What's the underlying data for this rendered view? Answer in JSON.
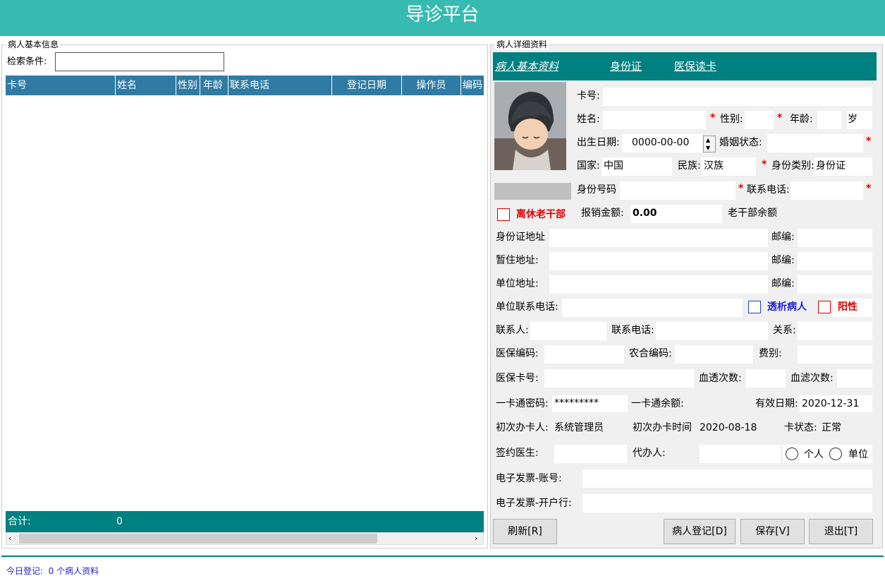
{
  "app": {
    "title": "导诊平台"
  },
  "left": {
    "group_title": "病人基本信息",
    "search_label": "检索条件:",
    "search_value": "",
    "columns": [
      "卡号",
      "姓名",
      "性别",
      "年龄",
      "联系电话",
      "登记日期",
      "操作员",
      "编码"
    ],
    "total_label": "合计:",
    "total_value": "0"
  },
  "right": {
    "group_title": "病人详细资料",
    "tabs": [
      "病人基本资料",
      "身份证",
      "医保读卡"
    ],
    "labels": {
      "card_no": "卡号:",
      "name": "姓名:",
      "gender": "性别:",
      "age": "年龄:",
      "age_unit": "岁",
      "birth_date": "出生日期:",
      "marital": "婚姻状态:",
      "country": "国家:",
      "ethnicity": "民族:",
      "id_type": "身份类别:",
      "id_no": "身份号码",
      "phone": "联系电话:",
      "retired": "离休老干部",
      "reimburse": "报销金额:",
      "cadre_balance": "老干部余额",
      "id_address": "身份证地址",
      "postcode": "邮编:",
      "temp_address": "暂住地址:",
      "work_address": "单位地址:",
      "work_phone": "单位联系电话:",
      "dialysis": "透析病人",
      "positive": "阳性",
      "contact": "联系人:",
      "contact_phone": "联系电话:",
      "relation": "关系:",
      "ins_code": "医保编码:",
      "coop_code": "农合编码:",
      "fee_type": "费别:",
      "ins_card": "医保卡号:",
      "dialysis_count": "血透次数:",
      "filter_count": "血滤次数:",
      "card_pwd": "一卡通密码:",
      "card_balance": "一卡通余额:",
      "valid_date": "有效日期:",
      "first_issuer": "初次办卡人:",
      "first_time": "初次办卡时间",
      "card_state": "卡状态:",
      "doctor": "签约医生:",
      "agent": "代办人:",
      "radio_personal": "个人",
      "radio_unit": "单位",
      "invoice_account": "电子发票-账号:",
      "invoice_bank": "电子发票-开户行:"
    },
    "values": {
      "birth_date": "0000-00-00",
      "country": "中国",
      "ethnicity": "汉族",
      "id_type": "身份证",
      "reimburse": "0.00",
      "card_pwd": "*********",
      "valid_date": "2020-12-31",
      "first_issuer": "系统管理员",
      "first_time": "2020-08-18",
      "card_state": "正常"
    },
    "buttons": {
      "refresh": "刷新[R]",
      "register": "病人登记[D]",
      "save": "保存[V]",
      "exit": "退出[T]"
    }
  },
  "status": {
    "text": "今日登记:  0 个病人资料"
  },
  "colors": {
    "header": "#37bbb1",
    "teal": "#008080",
    "table_header": "#2f7ba4",
    "required": "#e00000",
    "status_text": "#1f1fd6"
  }
}
